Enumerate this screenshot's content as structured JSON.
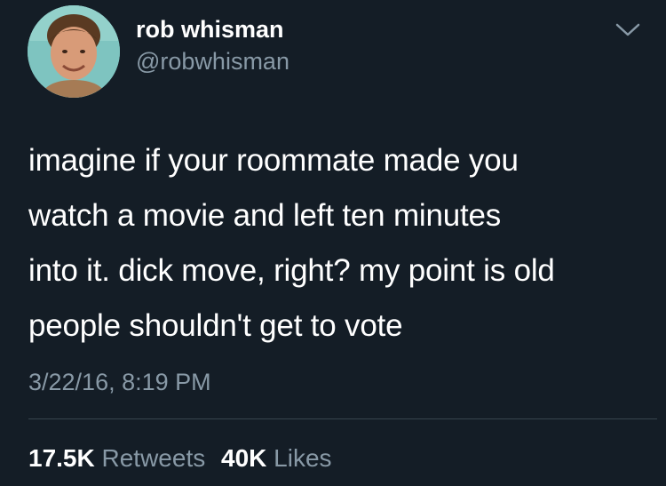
{
  "author": {
    "display_name": "rob whisman",
    "handle": "@robwhisman",
    "avatar_icon": "profile-photo"
  },
  "tweet": {
    "lines": [
      "imagine if your roommate made you",
      "watch a movie and left ten minutes",
      "into it. dick move, right? my point is old",
      "people shouldn't get to vote"
    ],
    "timestamp": "3/22/16, 8:19 PM"
  },
  "stats": {
    "retweets_count": "17.5K",
    "retweets_label": "Retweets",
    "likes_count": "40K",
    "likes_label": "Likes"
  },
  "theme": {
    "background": "#141d26",
    "primary_text": "#ffffff",
    "secondary_text": "#8899a6",
    "divider": "#38444d"
  }
}
